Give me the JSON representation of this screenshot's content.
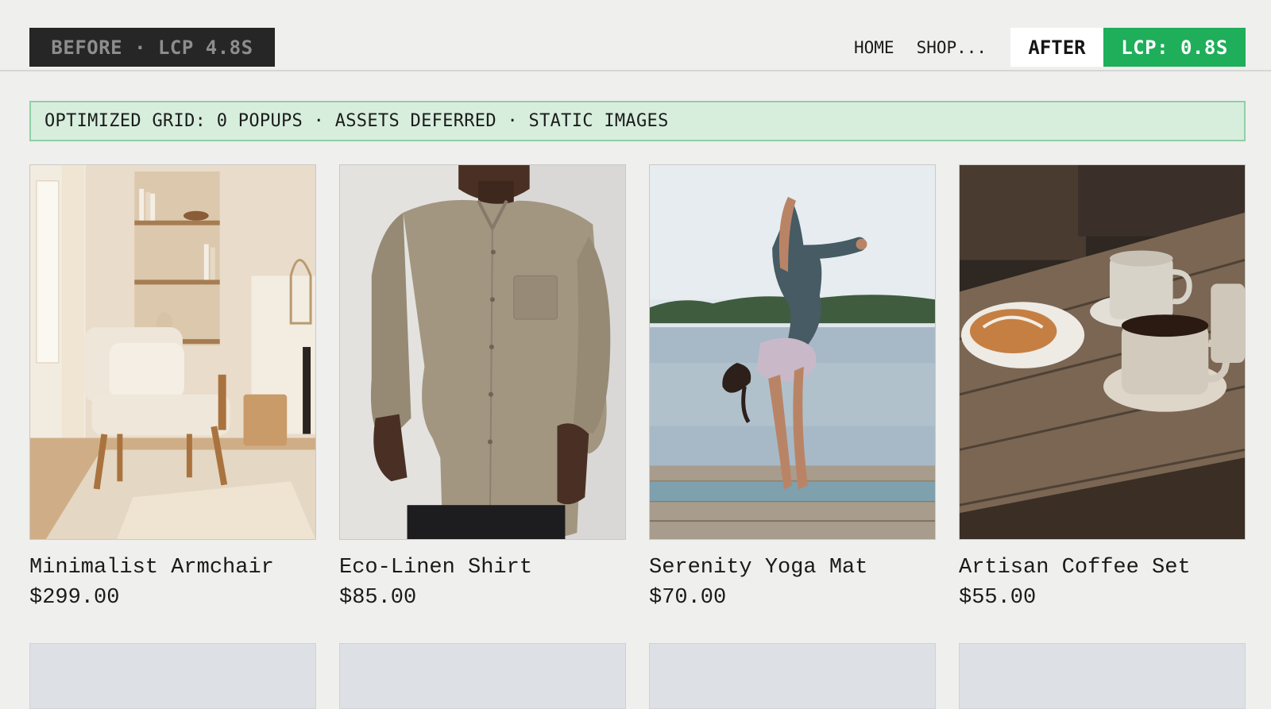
{
  "header": {
    "before_badge": "BEFORE · LCP 4.8S",
    "nav": [
      "HOME",
      "SHOP..."
    ],
    "after_tab": "AFTER",
    "lcp_badge": "LCP: 0.8S"
  },
  "banner": {
    "text": "OPTIMIZED GRID: 0 POPUPS · ASSETS DEFERRED · STATIC IMAGES"
  },
  "products": [
    {
      "name": "Minimalist Armchair",
      "price": "$299.00",
      "image": "armchair-photo"
    },
    {
      "name": "Eco-Linen Shirt",
      "price": "$85.00",
      "image": "linen-shirt-photo"
    },
    {
      "name": "Serenity Yoga Mat",
      "price": "$70.00",
      "image": "yoga-mat-photo"
    },
    {
      "name": "Artisan Coffee Set",
      "price": "$55.00",
      "image": "coffee-set-photo"
    }
  ],
  "colors": {
    "accent_green": "#1fae5a",
    "banner_bg": "#d7eedd",
    "before_bg": "#262626",
    "placeholder": "#dde0e4"
  }
}
